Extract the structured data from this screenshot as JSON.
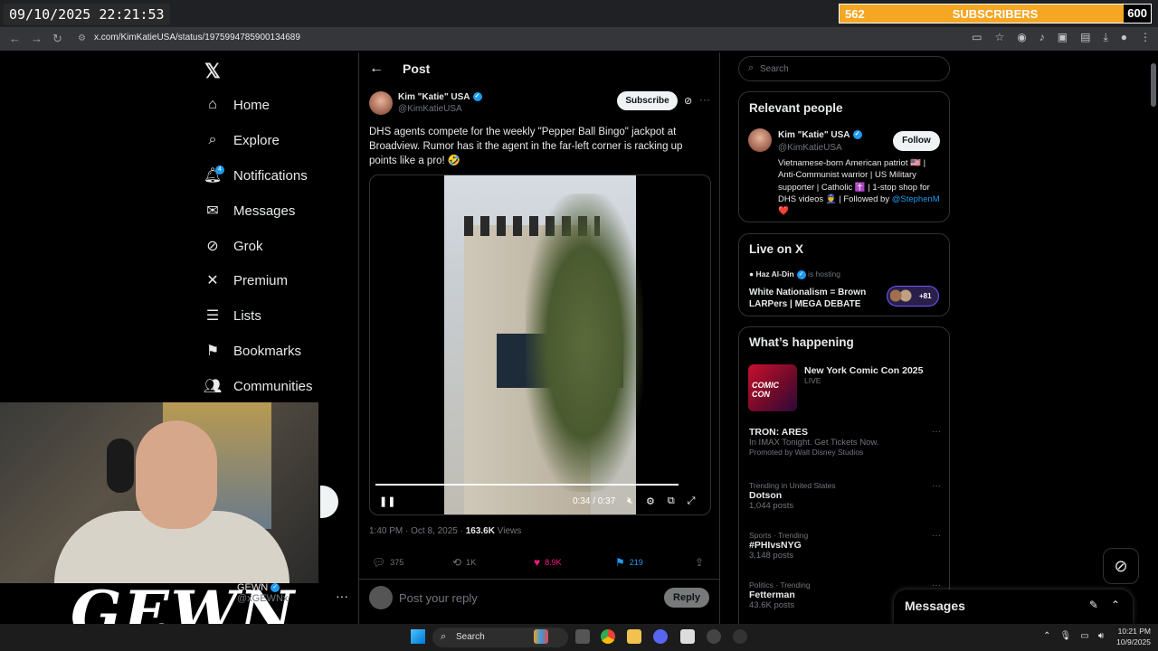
{
  "overlay": {
    "clock": "09/10/2025 22:21:53",
    "subs_count": "562",
    "subs_label": "SUBSCRIBERS",
    "subs_goal": "600",
    "streamer_logo": "GEWN"
  },
  "browser": {
    "url": "x.com/KimKatieUSA/status/1975994785900134689"
  },
  "nav": {
    "items": [
      {
        "label": "Home",
        "icon": "home-icon"
      },
      {
        "label": "Explore",
        "icon": "search-icon"
      },
      {
        "label": "Notifications",
        "icon": "bell-icon"
      },
      {
        "label": "Messages",
        "icon": "mail-icon"
      },
      {
        "label": "Grok",
        "icon": "grok-icon"
      },
      {
        "label": "Premium",
        "icon": "x-icon"
      },
      {
        "label": "Lists",
        "icon": "list-icon"
      },
      {
        "label": "Bookmarks",
        "icon": "bookmark-icon"
      },
      {
        "label": "Communities",
        "icon": "people-icon"
      }
    ],
    "notif_badge": "4",
    "profile_name": "GEWN",
    "profile_handle": "@xGEWNx"
  },
  "post": {
    "header": "Post",
    "author_name": "Kim \"Katie\" USA",
    "author_handle": "@KimKatieUSA",
    "subscribe_label": "Subscribe",
    "text": "DHS agents compete for the weekly \"Pepper Ball Bingo\" jackpot at Broadview. Rumor has it the agent in the far-left corner is racking up points like a pro! 🤣",
    "video_time": "0:34 / 0:37",
    "video_progress": 0.92,
    "time_posted": "1:40 PM · Oct 8, 2025 · ",
    "views_count": "163.6K",
    "views_label": " Views",
    "replies": "375",
    "reposts": "1K",
    "likes": "8.9K",
    "bookmarks": "219",
    "reply_placeholder": "Post your reply",
    "reply_button": "Reply"
  },
  "sidebar": {
    "search_placeholder": "Search",
    "relevant_title": "Relevant people",
    "rp_name": "Kim \"Katie\" USA",
    "rp_handle": "@KimKatieUSA",
    "follow_label": "Follow",
    "rp_bio": "Vietnamese-born American patriot 🇺🇸 | Anti-Communist warrior | US Military supporter | Catholic ✝️ | 1-stop shop for DHS videos 👮 | Followed by ",
    "rp_bio_mention": "@StephenM",
    "rp_bio_heart": " ❤️",
    "live_title": "Live on X",
    "live_host": "Haz Al-Din",
    "live_hosting": " is hosting",
    "live_space_title": "White Nationalism = Brown LARPers | MEGA DEBATE",
    "live_listeners": "+81",
    "happening_title": "What’s happening",
    "trends": [
      {
        "context": "",
        "name": "New York Comic Con 2025",
        "sub": "LIVE"
      },
      {
        "context": "",
        "name": "TRON: ARES",
        "sub": "In IMAX Tonight. Get Tickets Now.",
        "promo": "Promoted by Walt Disney Studios"
      },
      {
        "context": "Trending in United States",
        "name": "Dotson",
        "sub": "1,044 posts"
      },
      {
        "context": "Sports · Trending",
        "name": "#PHIvsNYG",
        "sub": "3,148 posts"
      },
      {
        "context": "Politics · Trending",
        "name": "Fetterman",
        "sub": "43.6K posts"
      }
    ],
    "nycc_image_text": "COMIC CON"
  },
  "messages_drawer": {
    "title": "Messages"
  },
  "taskbar": {
    "search_label": "Search",
    "time": "10:21 PM",
    "date": "10/9/2025"
  },
  "colors": {
    "accent": "#1d9bf0",
    "like": "#f91880",
    "subs_bar": "#f5a623"
  }
}
